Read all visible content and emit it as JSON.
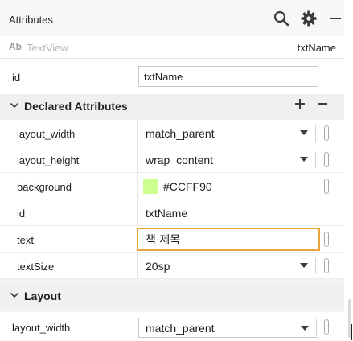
{
  "panel": {
    "title": "Attributes",
    "icons": [
      "search-icon",
      "gear-icon",
      "minimize-icon"
    ]
  },
  "component": {
    "badge": "Ab",
    "type": "TextView",
    "id": "txtName"
  },
  "id_field": {
    "label": "id",
    "value": "txtName"
  },
  "declared": {
    "title": "Declared Attributes",
    "add_icon": "plus-icon",
    "remove_icon": "minus-icon",
    "rows": [
      {
        "name": "layout_width",
        "value": "match_parent"
      },
      {
        "name": "layout_height",
        "value": "wrap_content"
      },
      {
        "name": "background",
        "value": "#CCFF90"
      },
      {
        "name": "id",
        "value": "txtName"
      },
      {
        "name": "text",
        "value": "책 제목"
      },
      {
        "name": "textSize",
        "value": "20sp"
      }
    ]
  },
  "layout": {
    "title": "Layout",
    "rows": [
      {
        "name": "layout_width",
        "value": "match_parent"
      }
    ]
  },
  "colors": {
    "background_swatch": "#CCFF90",
    "focus_border": "#e8a33d"
  }
}
